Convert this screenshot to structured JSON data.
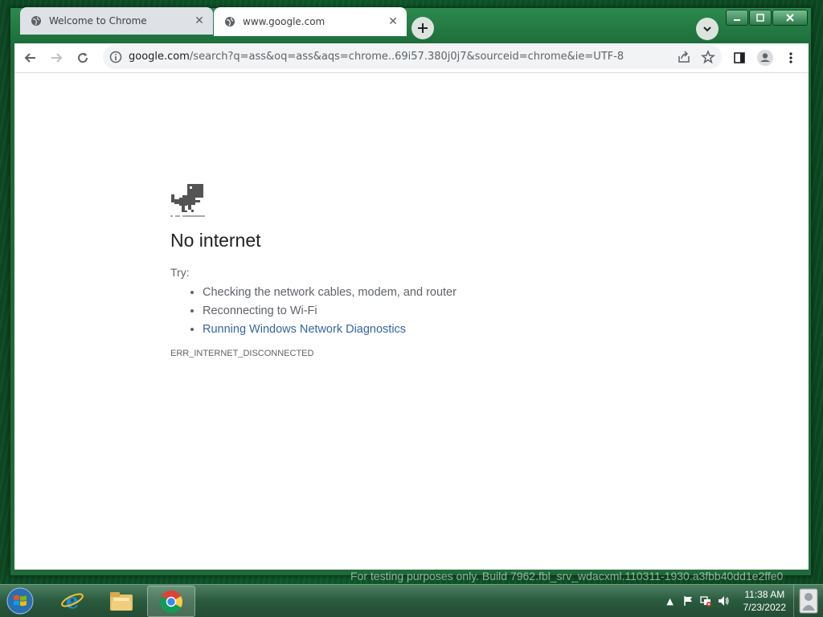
{
  "browser": {
    "tabs": [
      {
        "title": "Welcome to Chrome",
        "favicon": "globe-icon",
        "active": false
      },
      {
        "title": "www.google.com",
        "favicon": "globe-icon",
        "active": true
      }
    ],
    "address": {
      "host": "google.com",
      "path": "/search?q=ass&oq=ass&aqs=chrome..69i57.380j0j7&sourceid=chrome&ie=UTF-8"
    }
  },
  "error_page": {
    "title": "No internet",
    "try_label": "Try:",
    "suggestions": [
      "Checking the network cables, modem, and router",
      "Reconnecting to Wi-Fi"
    ],
    "diagnostics_link": "Running Windows Network Diagnostics",
    "error_code": "ERR_INTERNET_DISCONNECTED"
  },
  "watermark": "For testing purposes only. Build 7962.fbl_srv_wdacxml.110311-1930.a3fbb40dd1e2ffe0",
  "taskbar": {
    "time": "11:38 AM",
    "date": "7/23/2022"
  }
}
